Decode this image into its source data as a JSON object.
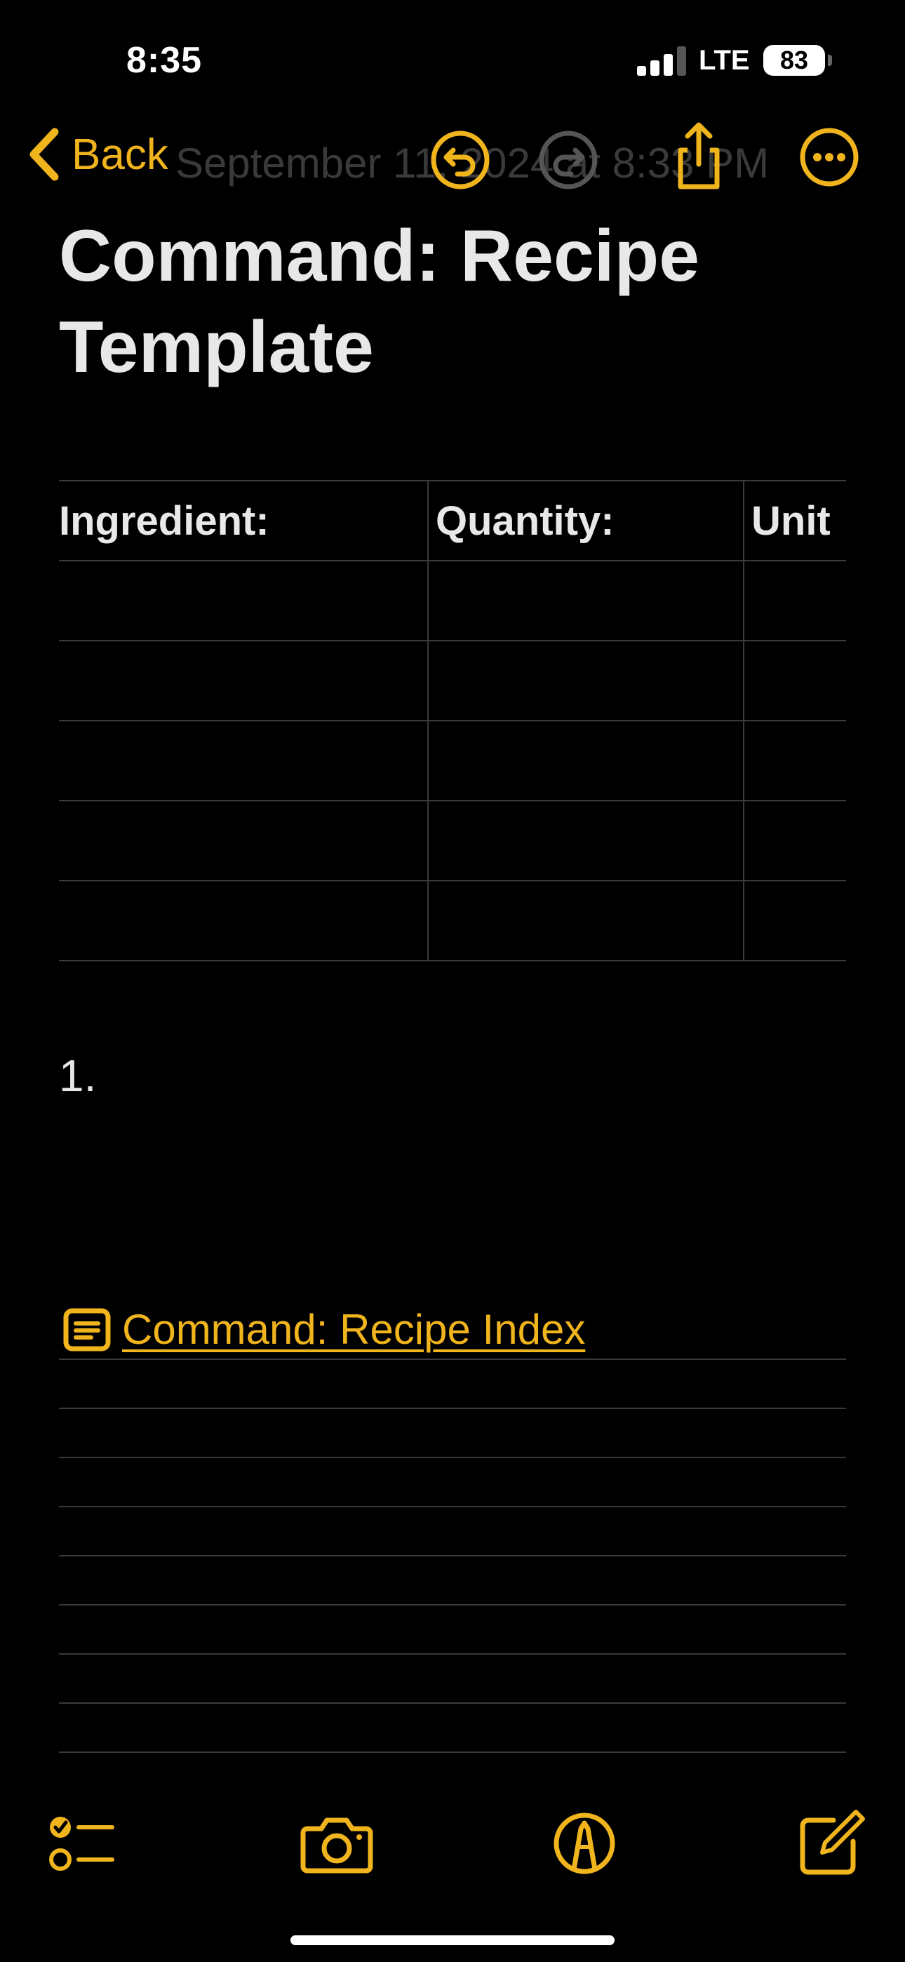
{
  "status_bar": {
    "time": "8:35",
    "network": "LTE",
    "battery": "83"
  },
  "nav": {
    "back_label": "Back",
    "faded_subtitle": "September 11, 2024 at 8:33 PM"
  },
  "note": {
    "title": "Command: Recipe Template",
    "table": {
      "headers": [
        "Ingredient:",
        "Quantity:",
        "Unit"
      ],
      "empty_rows": 5
    },
    "list_number": "1.",
    "link_label": "Command: Recipe Index"
  },
  "colors": {
    "accent": "#f0b41c",
    "background": "#000000",
    "text": "#e8e8e8",
    "rule": "#3a3a3a"
  },
  "icons": {
    "nav": [
      "chevron-left-icon",
      "undo-icon",
      "redo-icon",
      "share-icon",
      "more-icon"
    ],
    "toolbar": [
      "checklist-icon",
      "camera-icon",
      "markup-icon",
      "compose-icon"
    ]
  }
}
